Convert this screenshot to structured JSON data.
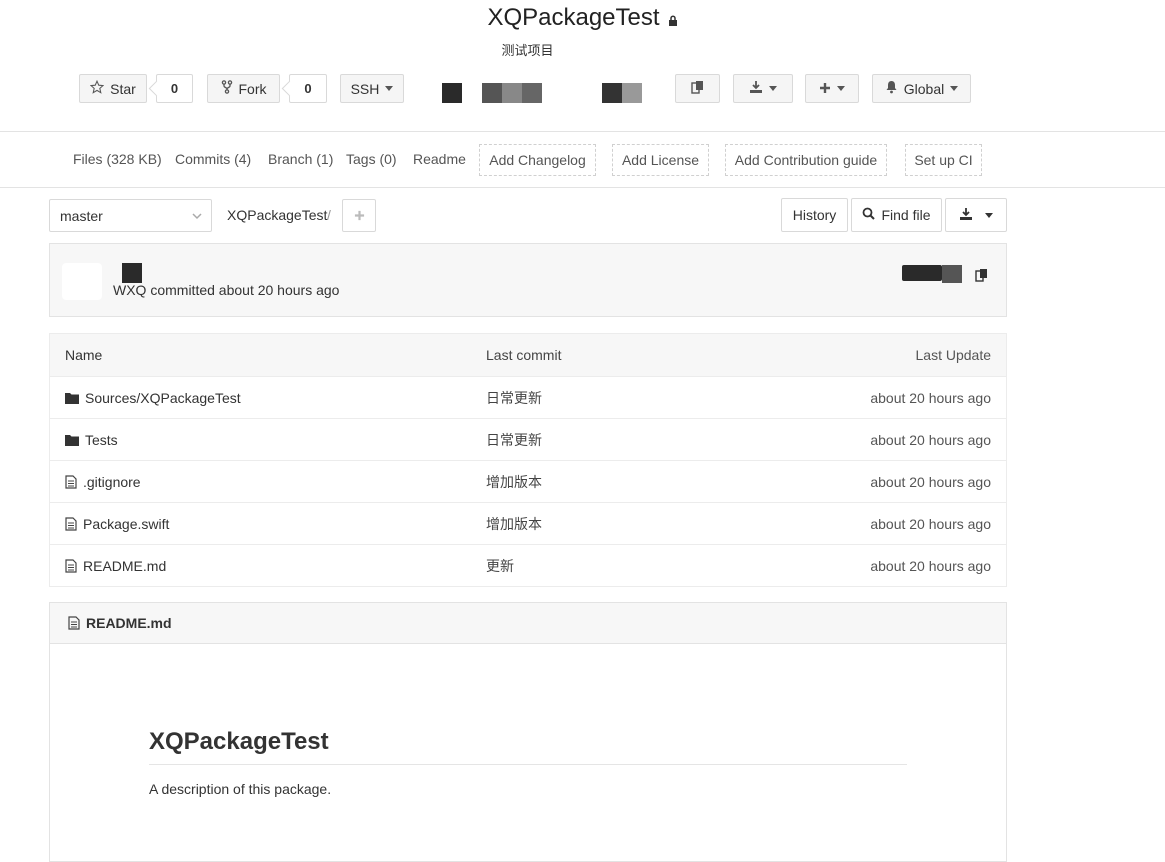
{
  "repo": {
    "title": "XQPackageTest",
    "description": "测试项目"
  },
  "actions": {
    "star_label": "Star",
    "star_count": "0",
    "fork_label": "Fork",
    "fork_count": "0",
    "protocol_label": "SSH",
    "notify_label": "Global"
  },
  "tabs": {
    "files": "Files (328 KB)",
    "commits": "Commits (4)",
    "branch": "Branch (1)",
    "tags": "Tags (0)",
    "readme": "Readme",
    "add_changelog": "Add Changelog",
    "add_license": "Add License",
    "add_contribution": "Add Contribution guide",
    "setup_ci": "Set up CI"
  },
  "branch_bar": {
    "branch": "master",
    "breadcrumb": "XQPackageTest",
    "separator": "/",
    "history_label": "History",
    "find_file_label": "Find file"
  },
  "latest_commit": {
    "text": "WXQ committed about 20 hours ago"
  },
  "file_table": {
    "headers": {
      "name": "Name",
      "last_commit": "Last commit",
      "last_update": "Last Update"
    },
    "rows": [
      {
        "type": "folder",
        "name": "Sources/XQPackageTest",
        "commit": "日常更新",
        "updated": "about 20 hours ago"
      },
      {
        "type": "folder",
        "name": "Tests",
        "commit": "日常更新",
        "updated": "about 20 hours ago"
      },
      {
        "type": "file",
        "name": ".gitignore",
        "commit": "增加版本",
        "updated": "about 20 hours ago"
      },
      {
        "type": "file",
        "name": "Package.swift",
        "commit": "增加版本",
        "updated": "about 20 hours ago"
      },
      {
        "type": "file",
        "name": "README.md",
        "commit": "更新",
        "updated": "about 20 hours ago"
      }
    ]
  },
  "readme": {
    "filename": "README.md",
    "heading": "XQPackageTest",
    "body": "A description of this package."
  }
}
